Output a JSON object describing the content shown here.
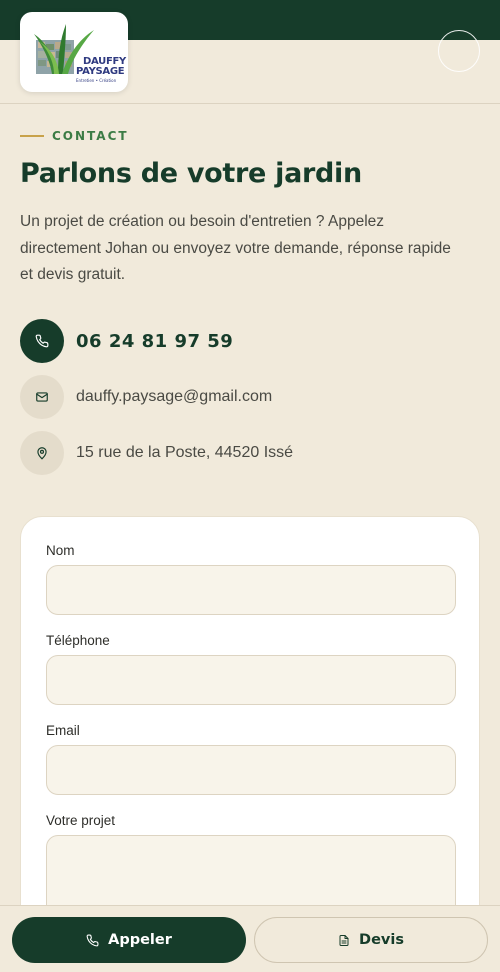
{
  "header": {
    "logo": {
      "line1": "DAUFFY",
      "line2": "PAYSAGE",
      "tagline": "Entretien • Création"
    },
    "menu_icon": "menu-icon"
  },
  "contact": {
    "eyebrow": "CONTACT",
    "title": "Parlons de votre jardin",
    "intro": "Un projet de création ou besoin d'entretien ? Appelez directement Johan ou envoyez votre demande, réponse rapide et devis gratuit.",
    "phone": "06 24 81 97 59",
    "email": "dauffy.paysage@gmail.com",
    "address": "15 rue de la Poste, 44520 Issé",
    "icons": {
      "phone": "phone-icon",
      "email": "mail-icon",
      "address": "map-pin-icon"
    }
  },
  "form": {
    "fields": [
      {
        "label": "Nom",
        "value": ""
      },
      {
        "label": "Téléphone",
        "value": ""
      },
      {
        "label": "Email",
        "value": ""
      },
      {
        "label": "Votre projet",
        "value": ""
      }
    ]
  },
  "bottom_bar": {
    "call_label": "Appeler",
    "quote_label": "Devis"
  },
  "colors": {
    "primary_green": "#163c2a",
    "accent_gold": "#c8a24a",
    "eyebrow_green": "#3c7c45",
    "background": "#f1eadb"
  }
}
